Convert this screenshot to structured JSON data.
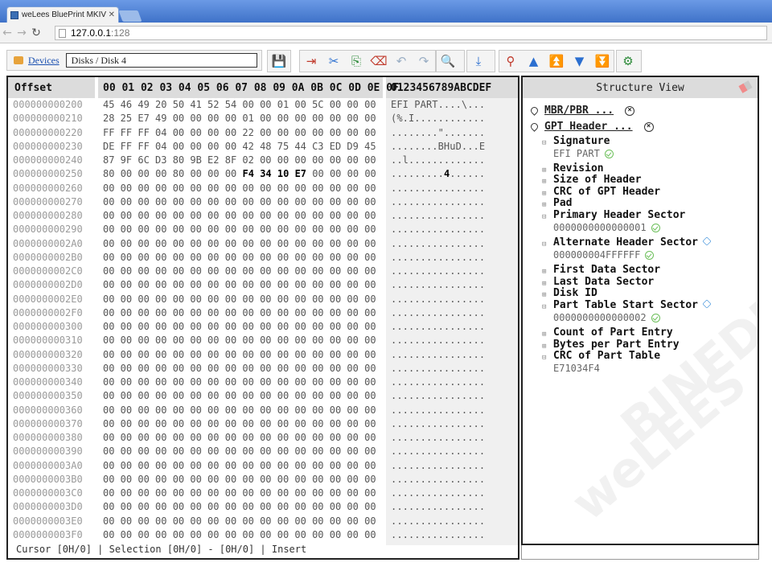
{
  "browser": {
    "tab_title": "weLees BluePrint MKIV Mod",
    "url_host": "127.0.0.1",
    "url_port": ":128"
  },
  "app": {
    "devices_link": "Devices",
    "path": "Disks / Disk 4"
  },
  "hex": {
    "header_offset": "Offset",
    "header_cols": [
      "00",
      "01",
      "02",
      "03",
      "04",
      "05",
      "06",
      "07",
      "08",
      "09",
      "0A",
      "0B",
      "0C",
      "0D",
      "0E",
      "0F"
    ],
    "header_ascii": "0123456789ABCDEF",
    "rows": [
      {
        "offset": "000000000200",
        "bytes": "45 46 49 20 50 41 52 54 00 00 01 00 5C 00 00 00",
        "ascii": "EFI PART....\\..."
      },
      {
        "offset": "000000000210",
        "bytes": "28 25 E7 49 00 00 00 00 01 00 00 00 00 00 00 00",
        "ascii": "(%.I............"
      },
      {
        "offset": "000000000220",
        "bytes": "FF FF FF 04 00 00 00 00 22 00 00 00 00 00 00 00",
        "ascii": "........\"......."
      },
      {
        "offset": "000000000230",
        "bytes": "DE FF FF 04 00 00 00 00 42 48 75 44 C3 ED D9 45",
        "ascii": "........BHuD...E"
      },
      {
        "offset": "000000000240",
        "bytes": "87 9F 6C D3 80 9B E2 8F 02 00 00 00 00 00 00 00",
        "ascii": "..l............."
      },
      {
        "offset": "000000000250",
        "bytes": "80 00 00 00 80 00 00 00 F4 34 10 E7 00 00 00 00",
        "ascii": ".........4......"
      },
      {
        "offset": "000000000260",
        "bytes": "00 00 00 00 00 00 00 00 00 00 00 00 00 00 00 00",
        "ascii": "................"
      },
      {
        "offset": "000000000270",
        "bytes": "00 00 00 00 00 00 00 00 00 00 00 00 00 00 00 00",
        "ascii": "................"
      },
      {
        "offset": "000000000280",
        "bytes": "00 00 00 00 00 00 00 00 00 00 00 00 00 00 00 00",
        "ascii": "................"
      },
      {
        "offset": "000000000290",
        "bytes": "00 00 00 00 00 00 00 00 00 00 00 00 00 00 00 00",
        "ascii": "................"
      },
      {
        "offset": "0000000002A0",
        "bytes": "00 00 00 00 00 00 00 00 00 00 00 00 00 00 00 00",
        "ascii": "................"
      },
      {
        "offset": "0000000002B0",
        "bytes": "00 00 00 00 00 00 00 00 00 00 00 00 00 00 00 00",
        "ascii": "................"
      },
      {
        "offset": "0000000002C0",
        "bytes": "00 00 00 00 00 00 00 00 00 00 00 00 00 00 00 00",
        "ascii": "................"
      },
      {
        "offset": "0000000002D0",
        "bytes": "00 00 00 00 00 00 00 00 00 00 00 00 00 00 00 00",
        "ascii": "................"
      },
      {
        "offset": "0000000002E0",
        "bytes": "00 00 00 00 00 00 00 00 00 00 00 00 00 00 00 00",
        "ascii": "................"
      },
      {
        "offset": "0000000002F0",
        "bytes": "00 00 00 00 00 00 00 00 00 00 00 00 00 00 00 00",
        "ascii": "................"
      },
      {
        "offset": "000000000300",
        "bytes": "00 00 00 00 00 00 00 00 00 00 00 00 00 00 00 00",
        "ascii": "................"
      },
      {
        "offset": "000000000310",
        "bytes": "00 00 00 00 00 00 00 00 00 00 00 00 00 00 00 00",
        "ascii": "................"
      },
      {
        "offset": "000000000320",
        "bytes": "00 00 00 00 00 00 00 00 00 00 00 00 00 00 00 00",
        "ascii": "................"
      },
      {
        "offset": "000000000330",
        "bytes": "00 00 00 00 00 00 00 00 00 00 00 00 00 00 00 00",
        "ascii": "................"
      },
      {
        "offset": "000000000340",
        "bytes": "00 00 00 00 00 00 00 00 00 00 00 00 00 00 00 00",
        "ascii": "................"
      },
      {
        "offset": "000000000350",
        "bytes": "00 00 00 00 00 00 00 00 00 00 00 00 00 00 00 00",
        "ascii": "................"
      },
      {
        "offset": "000000000360",
        "bytes": "00 00 00 00 00 00 00 00 00 00 00 00 00 00 00 00",
        "ascii": "................"
      },
      {
        "offset": "000000000370",
        "bytes": "00 00 00 00 00 00 00 00 00 00 00 00 00 00 00 00",
        "ascii": "................"
      },
      {
        "offset": "000000000380",
        "bytes": "00 00 00 00 00 00 00 00 00 00 00 00 00 00 00 00",
        "ascii": "................"
      },
      {
        "offset": "000000000390",
        "bytes": "00 00 00 00 00 00 00 00 00 00 00 00 00 00 00 00",
        "ascii": "................"
      },
      {
        "offset": "0000000003A0",
        "bytes": "00 00 00 00 00 00 00 00 00 00 00 00 00 00 00 00",
        "ascii": "................"
      },
      {
        "offset": "0000000003B0",
        "bytes": "00 00 00 00 00 00 00 00 00 00 00 00 00 00 00 00",
        "ascii": "................"
      },
      {
        "offset": "0000000003C0",
        "bytes": "00 00 00 00 00 00 00 00 00 00 00 00 00 00 00 00",
        "ascii": "................"
      },
      {
        "offset": "0000000003D0",
        "bytes": "00 00 00 00 00 00 00 00 00 00 00 00 00 00 00 00",
        "ascii": "................"
      },
      {
        "offset": "0000000003E0",
        "bytes": "00 00 00 00 00 00 00 00 00 00 00 00 00 00 00 00",
        "ascii": "................"
      },
      {
        "offset": "0000000003F0",
        "bytes": "00 00 00 00 00 00 00 00 00 00 00 00 00 00 00 00",
        "ascii": "................"
      }
    ],
    "status": "Cursor [0H/0] | Selection [0H/0] - [0H/0] | Insert"
  },
  "structure": {
    "title": "Structure View",
    "watermark": "BINEDIT",
    "watermark2": "weLEES",
    "roots": [
      "MBR/PBR ...",
      "GPT Header ..."
    ],
    "fields": {
      "signature": "Signature",
      "signature_val": "EFI PART",
      "revision": "Revision",
      "size_header": "Size of Header",
      "crc_header": "CRC of GPT Header",
      "pad": "Pad",
      "primary": "Primary Header Sector",
      "primary_val": "0000000000000001",
      "alternate": "Alternate Header Sector",
      "alternate_val": "000000004FFFFFF",
      "first_data": "First Data Sector",
      "last_data": "Last Data Sector",
      "disk_id": "Disk ID",
      "part_table": "Part Table Start Sector",
      "part_table_val": "0000000000000002",
      "count": "Count of Part Entry",
      "bytes_per": "Bytes per Part Entry",
      "crc_table": "CRC of Part Table",
      "crc_table_val": "E71034F4"
    }
  }
}
